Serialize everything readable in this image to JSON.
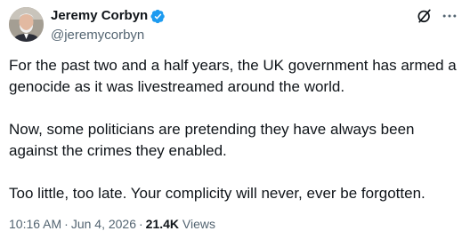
{
  "author": {
    "display_name": "Jeremy Corbyn",
    "handle": "@jeremycorbyn",
    "verified": true,
    "avatar_icon": "profile-photo"
  },
  "actions": {
    "grok_icon": "grok-icon",
    "more_icon": "more-icon"
  },
  "tweet": {
    "paragraphs": [
      "For the past two and a half years, the UK government has armed a genocide as it was livestreamed around the world.",
      "Now, some politicians are pretending they have always been against the crimes they enabled.",
      "Too little, too late. Your complicity will never, ever be forgotten."
    ]
  },
  "meta": {
    "time": "10:16 AM",
    "separator": "·",
    "date": "Jun 4, 2026",
    "views_count": "21.4K",
    "views_label": "Views"
  },
  "colors": {
    "text": "#0f1419",
    "secondary": "#536471",
    "verified": "#1d9bf0"
  }
}
